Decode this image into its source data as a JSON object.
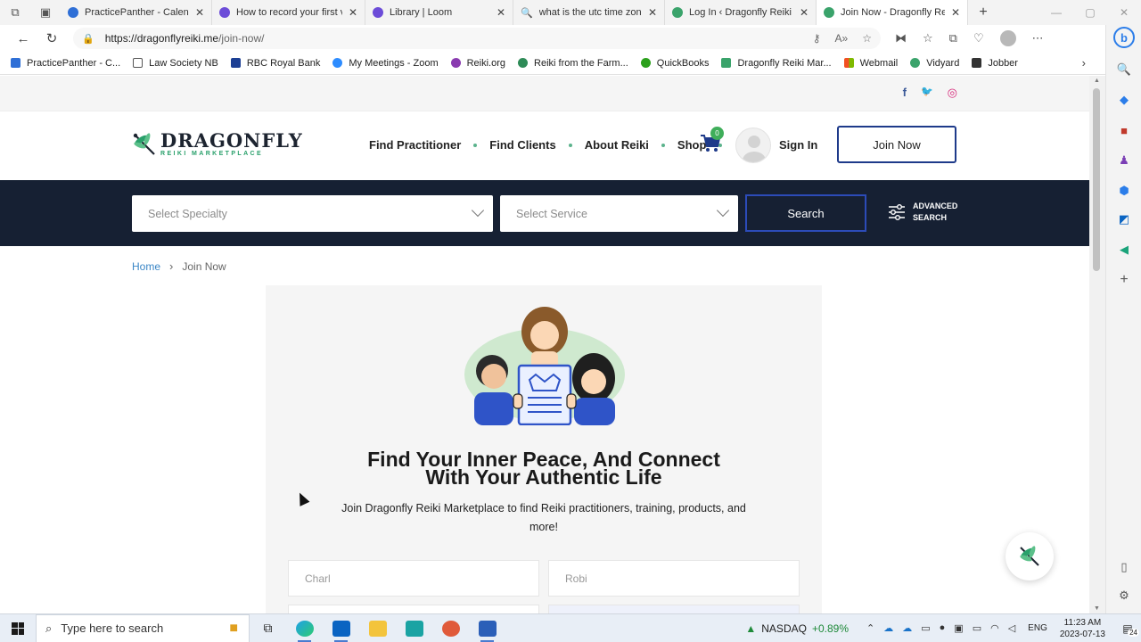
{
  "browser": {
    "tabs": [
      {
        "title": "PracticePanther - Calendar",
        "favicon_color": "#2f6fd6"
      },
      {
        "title": "How to record your first vi",
        "favicon_color": "#6c4cd8"
      },
      {
        "title": "Library | Loom",
        "favicon_color": "#6c4cd8"
      },
      {
        "title": "what is the utc time zone f",
        "favicon_color": "#2f6fd6"
      },
      {
        "title": "Log In ‹ Dragonfly Reiki M",
        "favicon_color": "#3aa36b"
      },
      {
        "title": "Join Now - Dragonfly Reiki",
        "favicon_color": "#3aa36b"
      }
    ],
    "url_domain": "https://dragonflyreiki.me",
    "url_path": "/join-now/",
    "bookmarks": [
      {
        "label": "PracticePanther - C...",
        "color": "#2f6fd6"
      },
      {
        "label": "Law Society NB",
        "color": "#555555"
      },
      {
        "label": "RBC Royal Bank",
        "color": "#1c3f94"
      },
      {
        "label": "My Meetings - Zoom",
        "color": "#2d8cff"
      },
      {
        "label": "Reiki.org",
        "color": "#8a3bb0"
      },
      {
        "label": "Reiki from the Farm...",
        "color": "#2e8b57"
      },
      {
        "label": "QuickBooks",
        "color": "#2ca01c"
      },
      {
        "label": "Dragonfly Reiki Mar...",
        "color": "#3aa36b"
      },
      {
        "label": "Webmail",
        "color": "#e25a1c"
      },
      {
        "label": "Vidyard",
        "color": "#3aa36b"
      },
      {
        "label": "Jobber",
        "color": "#333333"
      }
    ]
  },
  "site": {
    "logo_line1": "DRAGONFLY",
    "logo_line2": "REIKI MARKETPLACE",
    "nav": [
      "Find Practitioner",
      "Find Clients",
      "About Reiki",
      "Shop"
    ],
    "cart_count": "0",
    "sign_in": "Sign In",
    "join_now": "Join Now",
    "social": [
      {
        "icon": "facebook-icon",
        "glyph": "f",
        "color": "#3b5998"
      },
      {
        "icon": "twitter-icon",
        "glyph": "🐦",
        "color": "#1da1f2"
      },
      {
        "icon": "instagram-icon",
        "glyph": "◎",
        "color": "#d6297a"
      }
    ],
    "search": {
      "specialty_placeholder": "Select Specialty",
      "service_placeholder": "Select Service",
      "button": "Search",
      "advanced_line1": "ADVANCED",
      "advanced_line2": "SEARCH"
    },
    "breadcrumb": {
      "home": "Home",
      "current": "Join Now"
    },
    "card": {
      "headline_line1": "Find Your Inner Peace, And Connect",
      "headline_line2": "With Your Authentic Life",
      "subtitle": "Join Dragonfly Reiki Marketplace to find Reiki practitioners, training, products, and more!",
      "first_name_value": "Charl",
      "last_name_value": "Robi"
    }
  },
  "taskbar": {
    "search_placeholder": "Type here to search",
    "stock_name": "NASDAQ",
    "stock_change": "+0.89%",
    "lang": "ENG",
    "time": "11:23 AM",
    "date": "2023-07-13",
    "notifications": "24"
  }
}
